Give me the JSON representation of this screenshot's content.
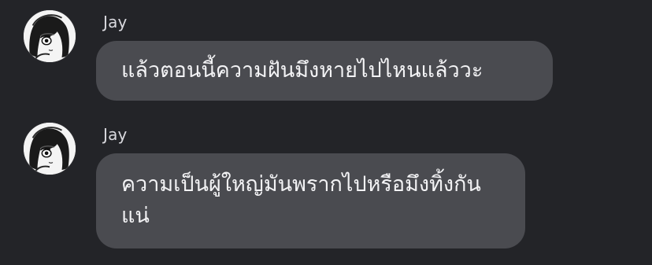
{
  "messages": [
    {
      "sender": "Jay",
      "avatar_icon": "anime-avatar-icon",
      "text": "แล้วตอนนี้ความฝันมึงหายไปไหนแล้ววะ"
    },
    {
      "sender": "Jay",
      "avatar_icon": "anime-avatar-icon",
      "text": "ความเป็นผู้ใหญ่มันพรากไปหรือมึงทิ้งกันแน่"
    }
  ],
  "colors": {
    "background": "#232428",
    "bubble": "#4a4b50",
    "text": "#f3f3f5",
    "sender": "#d9d9de"
  }
}
